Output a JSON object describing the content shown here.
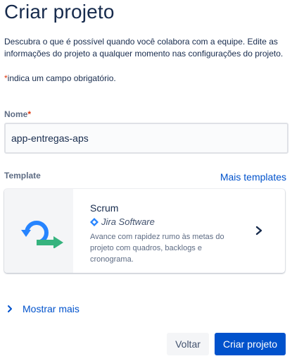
{
  "page": {
    "title": "Criar projeto",
    "description": "Descubra o que é possível quando você colabora com a equipe. Edite as informações do projeto a qualquer momento nas configurações do projeto.",
    "required_asterisk": "*",
    "required_note": "indica um campo obrigatório."
  },
  "name_field": {
    "label": "Nome",
    "required_marker": "*",
    "value": "app-entregas-aps"
  },
  "template": {
    "label": "Template",
    "more_link": "Mais templates",
    "card": {
      "title": "Scrum",
      "product": "Jira Software",
      "description": "Avance com rapidez rumo às metas do projeto com quadros, backlogs e cronograma.",
      "icon": "scrum-icon",
      "chevron_icon": "chevron-right-icon"
    }
  },
  "show_more": {
    "label": "Mostrar mais",
    "icon": "chevron-right-icon"
  },
  "actions": {
    "back_label": "Voltar",
    "create_label": "Criar projeto"
  },
  "colors": {
    "accent": "#0052cc",
    "required": "#de350b",
    "scrum_blue": "#2684ff",
    "scrum_green": "#36b37e"
  }
}
